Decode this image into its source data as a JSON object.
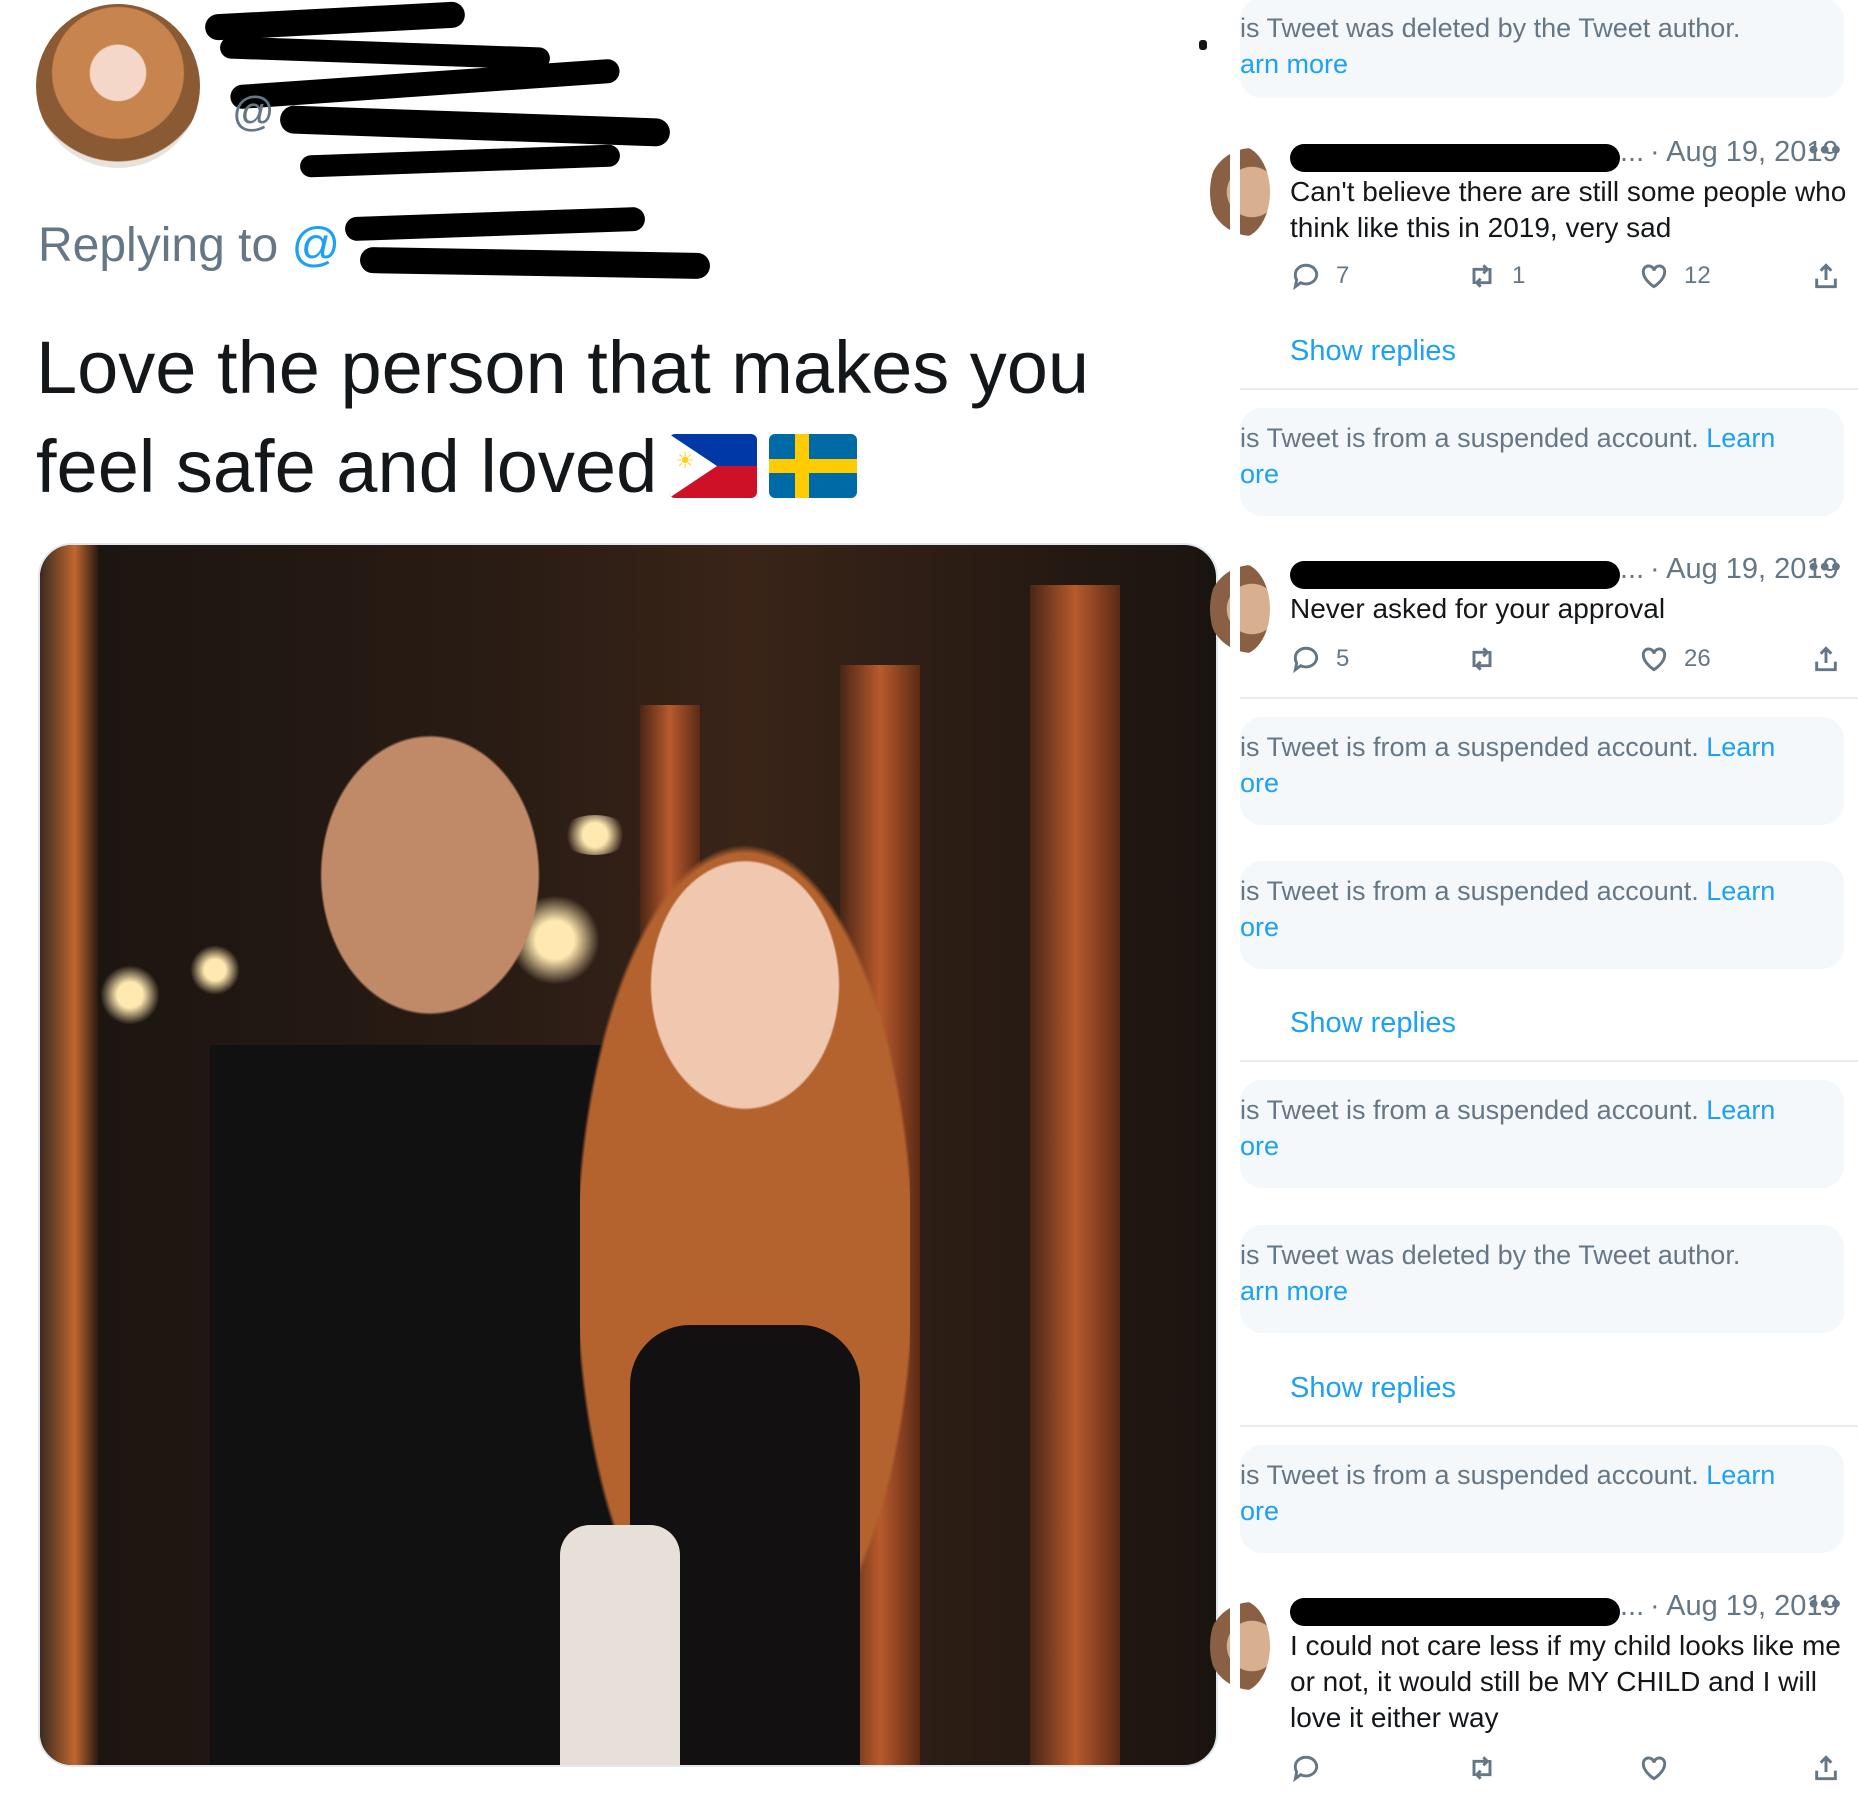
{
  "main_tweet": {
    "handle_prefix": "@",
    "replying_label": "Replying to ",
    "replying_at": "@",
    "text": "Love the person that makes you feel safe and loved",
    "flags": [
      "philippines-flag",
      "sweden-flag"
    ]
  },
  "thread": {
    "notices": [
      {
        "text": "is Tweet was deleted by the Tweet author.",
        "link": "arn more"
      },
      {
        "text": "is Tweet is from a suspended account. ",
        "link": "Learn",
        "link2": "ore"
      },
      {
        "text": "is Tweet is from a suspended account. ",
        "link": "Learn",
        "link2": "ore"
      },
      {
        "text": "is Tweet is from a suspended account. ",
        "link": "Learn",
        "link2": "ore"
      },
      {
        "text": "is Tweet is from a suspended account. ",
        "link": "Learn",
        "link2": "ore"
      },
      {
        "text": "is Tweet was deleted by the Tweet author.",
        "link": "arn more"
      },
      {
        "text": "is Tweet is from a suspended account. ",
        "link": "Learn",
        "link2": "ore"
      }
    ],
    "replies": [
      {
        "name_suffix": "...",
        "date": "· Aug 19, 2019",
        "more": "•••",
        "text": "Can't believe there are still some people who think like this in 2019, very sad",
        "reply_count": "7",
        "retweet_count": "1",
        "like_count": "12"
      },
      {
        "name_suffix": "...",
        "date": "· Aug 19, 2019",
        "more": "•••",
        "text": "Never asked for your approval",
        "reply_count": "5",
        "retweet_count": "",
        "like_count": "26"
      },
      {
        "name_suffix": "...",
        "date": "· Aug 19, 2019",
        "more": "•••",
        "text": "I could not care less if my child looks like me or not, it would still be MY CHILD and I will love it either way",
        "reply_count": "",
        "retweet_count": "",
        "like_count": ""
      }
    ],
    "show_replies_label": "Show replies"
  },
  "icons": {
    "reply": "reply-icon",
    "retweet": "retweet-icon",
    "like": "heart-icon",
    "share": "share-icon"
  },
  "colors": {
    "accent": "#1da1f2",
    "muted": "#657786",
    "notice_bg": "#f5f8fa",
    "text": "#14171a"
  }
}
